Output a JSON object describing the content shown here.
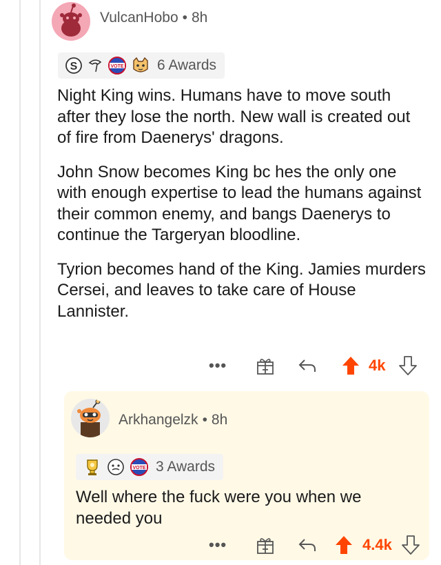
{
  "comment": {
    "username": "VulcanHobo",
    "separator": "•",
    "age": "8h",
    "awards_label": "6 Awards",
    "paragraphs": [
      "Night King wins. Humans have to move south after they lose the north. New wall is created out of fire from Daenerys' dragons.",
      "John Snow becomes King bc hes the only one with enough expertise to lead the humans against their common enemy, and bangs Daenerys to continue the Targeryan bloodline.",
      "Tyrion becomes hand of the King. Jamies murders Cersei, and leaves to take care of House Lannister."
    ],
    "more_label": "•••",
    "vote_count": "4k"
  },
  "reply": {
    "username": "Arkhangelzk",
    "separator": "•",
    "age": "8h",
    "awards_label": "3 Awards",
    "text": "Well where the fuck were you when we needed you",
    "more_label": "•••",
    "vote_count": "4.4k"
  },
  "colors": {
    "upvote": "#ff4500",
    "award_bg": "#f3f3f3",
    "reply_bg": "#fff9e6",
    "avatar_pink": "#f4a7b5",
    "meta_text": "#555555"
  },
  "icons": {
    "award_icons_top": [
      "silver-s-award-icon",
      "hat-award-icon",
      "vote-award-icon",
      "cat-award-icon"
    ],
    "award_icons_reply": [
      "trophy-award-icon",
      "face-award-icon",
      "vote-award-icon"
    ],
    "action_icons": [
      "more-icon",
      "gift-award-icon",
      "reply-arrow-icon",
      "upvote-arrow-icon",
      "downvote-arrow-icon"
    ]
  }
}
